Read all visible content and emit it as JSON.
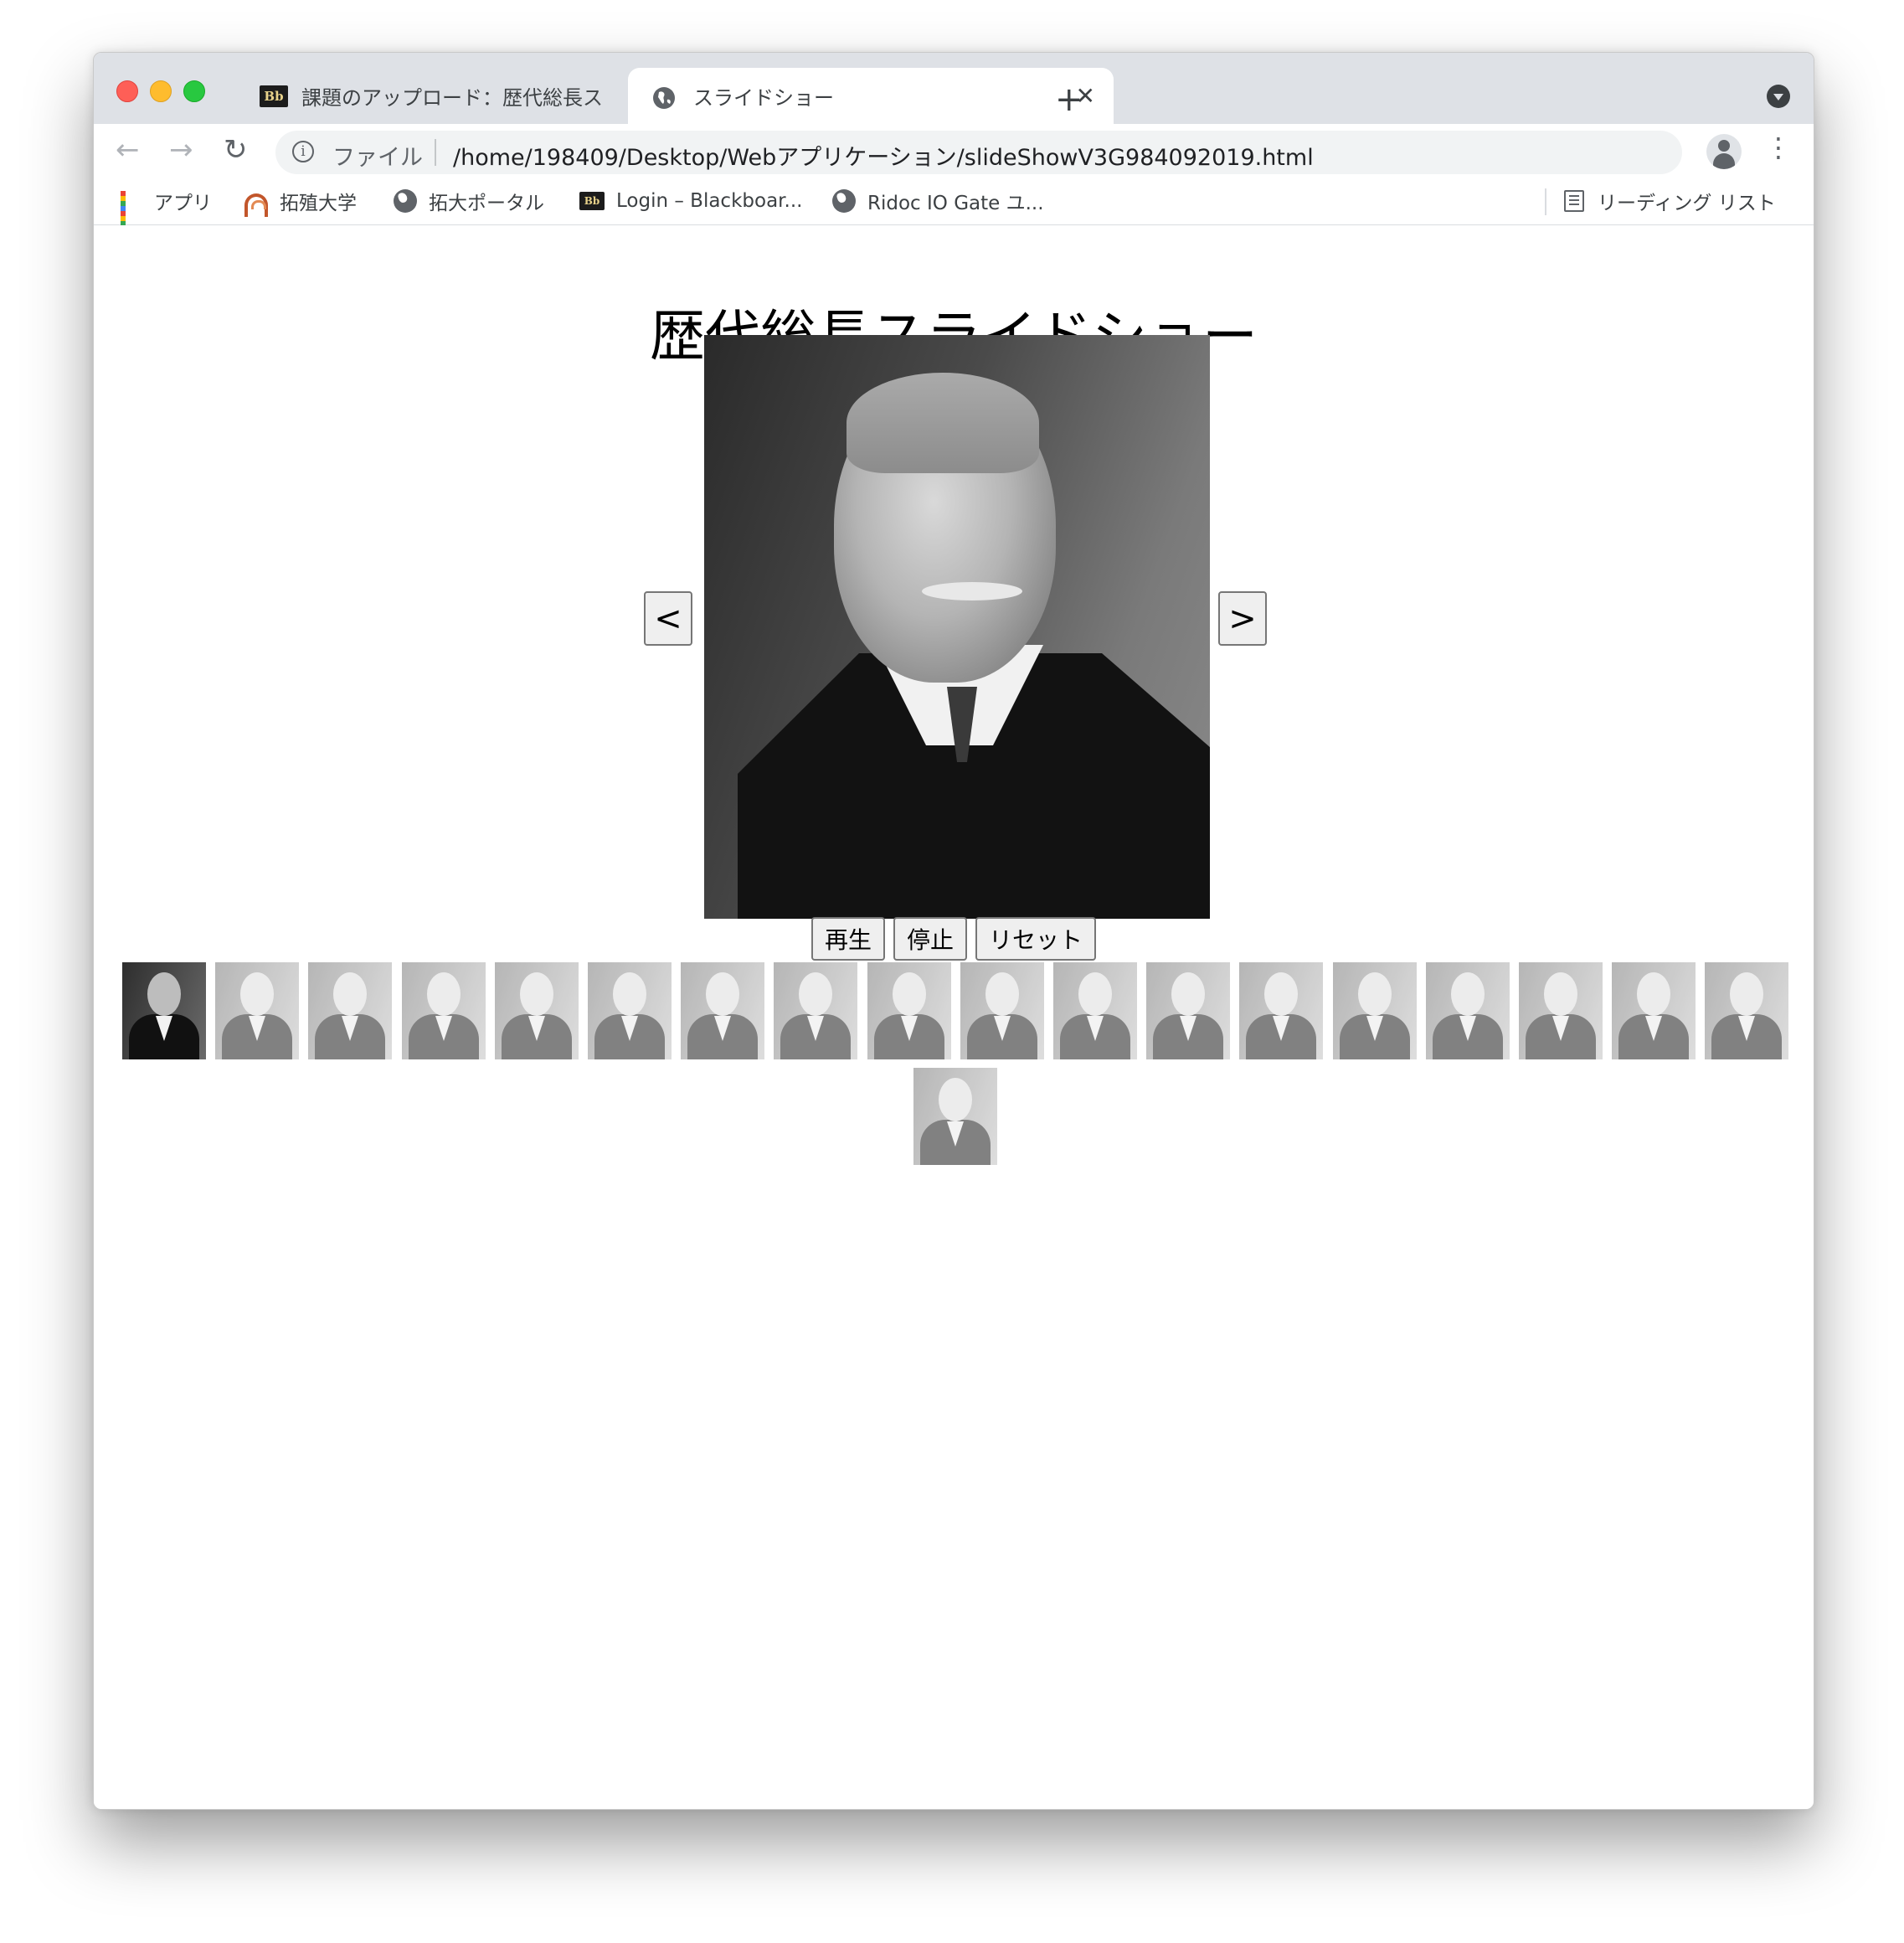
{
  "browser": {
    "tabs": [
      {
        "title": "課題のアップロード：歴代総長ス",
        "icon": "blackboard-icon",
        "active": false
      },
      {
        "title": "スライドショー",
        "icon": "globe-icon",
        "active": true
      }
    ],
    "bb_icon_text": "Bb",
    "new_tab_label": "+",
    "address": {
      "scheme_label": "ファイル",
      "url": "/home/198409/Desktop/Webアプリケーション/slideShowV3G984092019.html",
      "info_glyph": "i"
    },
    "bookmarks": [
      {
        "label": "アプリ",
        "icon": "apps-grid-icon"
      },
      {
        "label": "拓殖大学",
        "icon": "takushoku-logo-icon"
      },
      {
        "label": "拓大ポータル",
        "icon": "globe-icon"
      },
      {
        "label": "Login – Blackboar...",
        "icon": "blackboard-icon"
      },
      {
        "label": "Ridoc IO Gate ユ...",
        "icon": "globe-icon"
      }
    ],
    "reading_list_label": "リーディング リスト"
  },
  "page": {
    "title": "歴代総長スライドショー",
    "prev_label": "<",
    "next_label": ">",
    "controls": {
      "play": "再生",
      "stop": "停止",
      "reset": "リセット"
    },
    "current_index": 0,
    "thumbnail_count": 19
  }
}
